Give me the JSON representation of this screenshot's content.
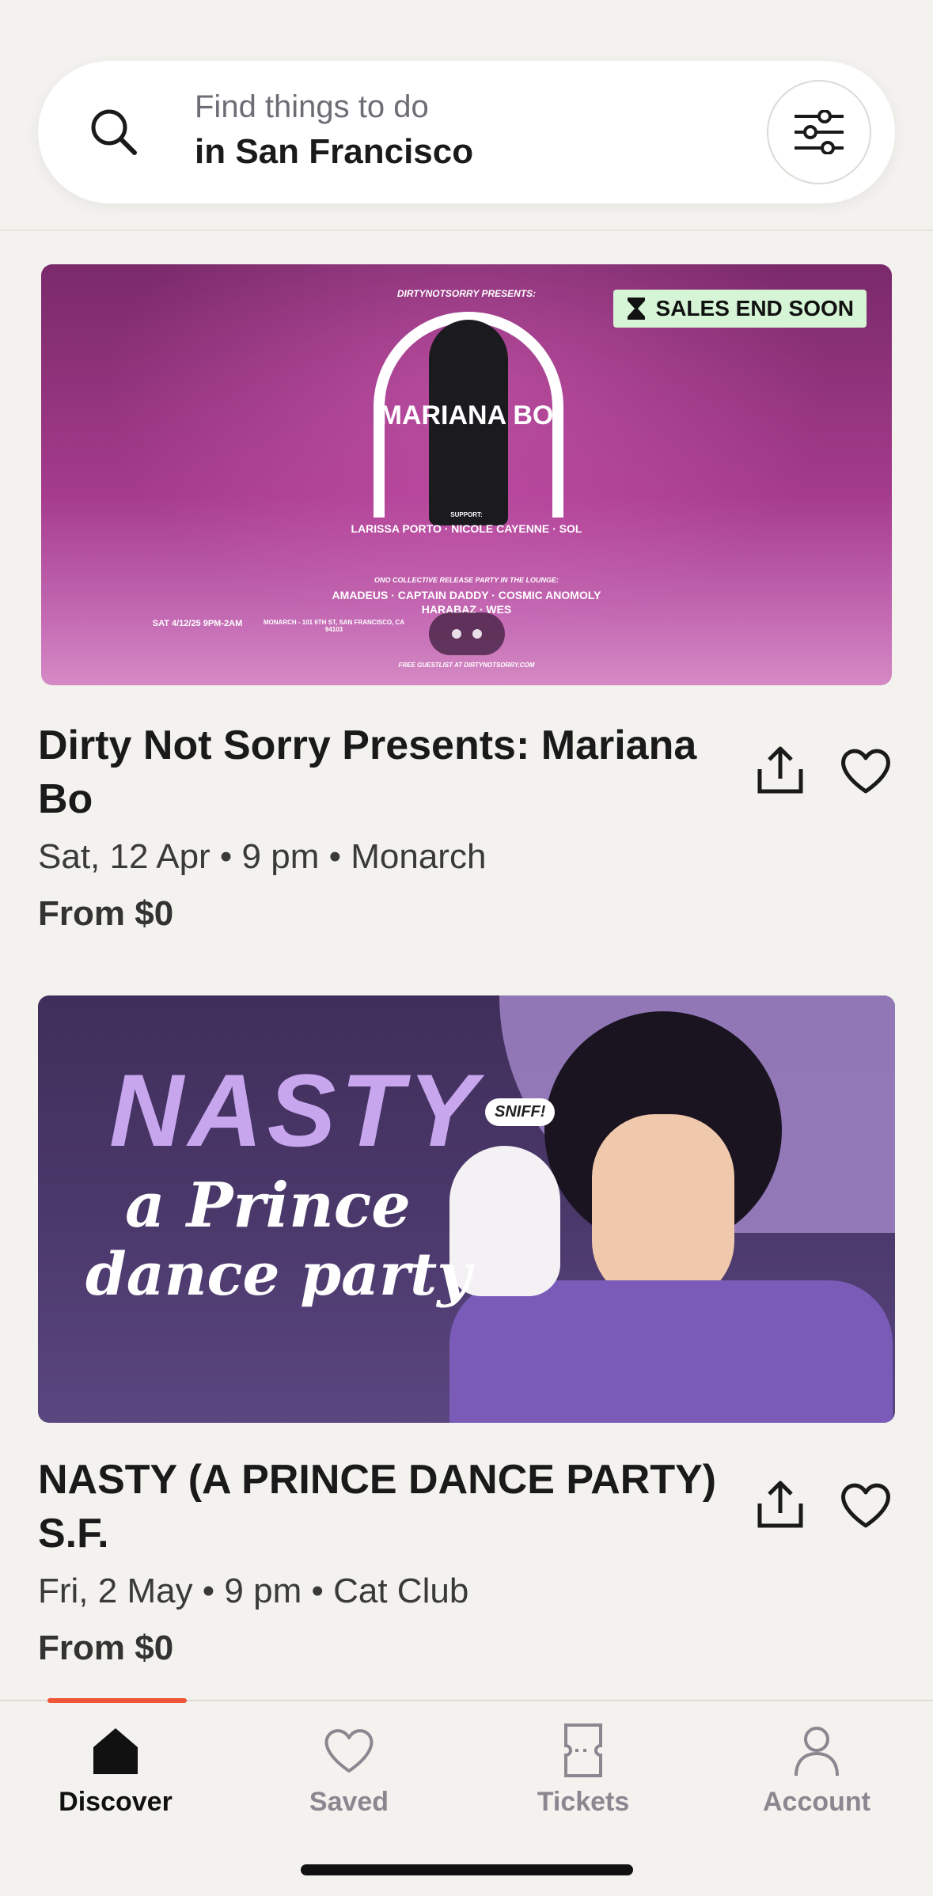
{
  "search": {
    "line1": "Find things to do",
    "line2": "in San Francisco"
  },
  "events": [
    {
      "badge": "SALES END SOON",
      "poster": {
        "presenter": "DIRTYNOTSORRY PRESENTS:",
        "headliner": "MARIANA BO",
        "support_label": "SUPPORT:",
        "support": "LARISSA PORTO · NICOLE CAYENNE · SOL",
        "lounge": "ONO COLLECTIVE RELEASE PARTY IN THE LOUNGE:",
        "lineup": "AMADEUS · CAPTAIN DADDY · COSMIC ANOMOLY",
        "lineup2": "HARABAZ · WES",
        "date": "SAT 4/12/25 9PM-2AM",
        "venue": "MONARCH - 101 6TH ST, SAN FRANCISCO, CA 94103",
        "footer": "FREE GUESTLIST AT DIRTYNOTSORRY.COM"
      },
      "title": "Dirty Not Sorry Presents: Mariana Bo",
      "meta": "Sat, 12 Apr • 9 pm • Monarch",
      "price": "From $0"
    },
    {
      "poster": {
        "word": "NASTY",
        "line1": "a Prince",
        "line2": "dance party",
        "sniff": "SNIFF!"
      },
      "title": "NASTY (A PRINCE DANCE PARTY) S.F.",
      "meta": "Fri, 2 May • 9 pm • Cat Club",
      "price": "From $0"
    }
  ],
  "nav": {
    "items": [
      {
        "label": "Discover",
        "icon": "home-icon",
        "active": true
      },
      {
        "label": "Saved",
        "icon": "heart-icon",
        "active": false
      },
      {
        "label": "Tickets",
        "icon": "ticket-icon",
        "active": false
      },
      {
        "label": "Account",
        "icon": "person-icon",
        "active": false
      }
    ],
    "accent": "#f05537"
  }
}
